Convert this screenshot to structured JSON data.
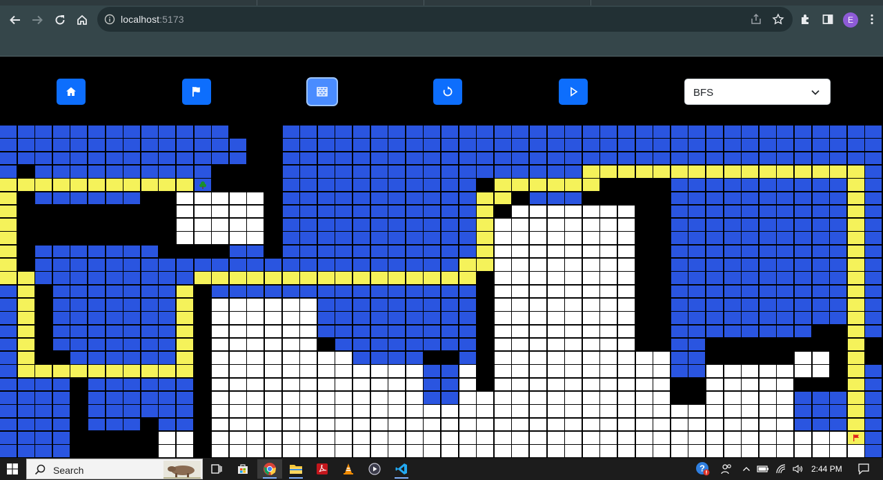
{
  "browser": {
    "url_host": "localhost",
    "url_port": ":5173",
    "profile_initial": "E"
  },
  "app": {
    "buttons": [
      {
        "name": "home-button",
        "icon": "home-icon"
      },
      {
        "name": "flag-button",
        "icon": "flag-icon"
      },
      {
        "name": "wall-button",
        "icon": "brick-wall-icon",
        "active": true
      },
      {
        "name": "reset-button",
        "icon": "rotate-icon"
      },
      {
        "name": "play-button",
        "icon": "play-icon"
      }
    ],
    "algorithm": {
      "selected": "BFS"
    },
    "colors": {
      "button": "#0d6efd",
      "visited": "#2a55e0",
      "path": "#f5f25a",
      "wall": "#000000",
      "empty": "#ffffff",
      "start": "#1a8f2a",
      "end": "#e0201a"
    }
  },
  "grid_legend": {
    "start": "start-node",
    "end": "end-node"
  },
  "taskbar": {
    "search_label": "Search",
    "clock": "2:44 PM",
    "apps": [
      "task-view",
      "store",
      "chrome",
      "file-explorer",
      "acrobat",
      "vlc",
      "media-player",
      "vscode"
    ]
  }
}
